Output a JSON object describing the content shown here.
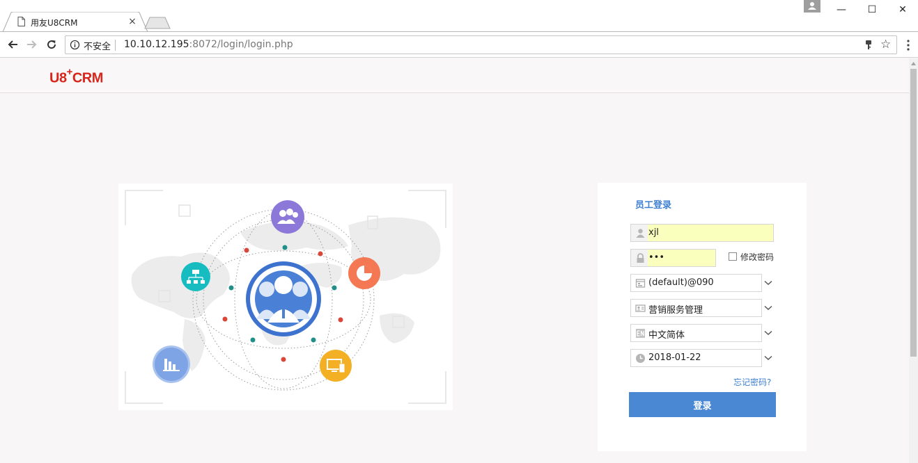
{
  "browser": {
    "tab_title": "用友U8CRM",
    "tab_close": "×",
    "security_label": "不安全",
    "url_host": "10.10.12.195",
    "url_rest": ":8072/login/login.php",
    "window_minimize": "—",
    "window_maximize": "☐",
    "window_close": "✕",
    "icons": [
      "back-icon",
      "forward-icon",
      "reload-icon",
      "info-icon",
      "key-icon",
      "star-icon",
      "menu-icon"
    ]
  },
  "header": {
    "logo_main": "U8",
    "logo_plus": "+",
    "logo_crm": "CRM"
  },
  "login": {
    "title": "员工登录",
    "username": "xjl",
    "password_mask": "•••",
    "change_password_label": "修改密码",
    "account_value": "(default)@090",
    "role_value": "营销服务管理",
    "language_value": "中文简体",
    "date_value": "2018-01-22",
    "forgot_label": "忘记密码?",
    "submit_label": "登录"
  },
  "colors": {
    "brand_red": "#d9261c",
    "accent_blue": "#4a88d4",
    "title_blue": "#3d7fd1",
    "autofill_yellow": "#faffbd",
    "node_purple": "#8b78d8",
    "node_teal": "#16bcc0",
    "node_orange": "#f37853",
    "node_yellow": "#f3b025",
    "node_blue": "#7ea4e5"
  }
}
